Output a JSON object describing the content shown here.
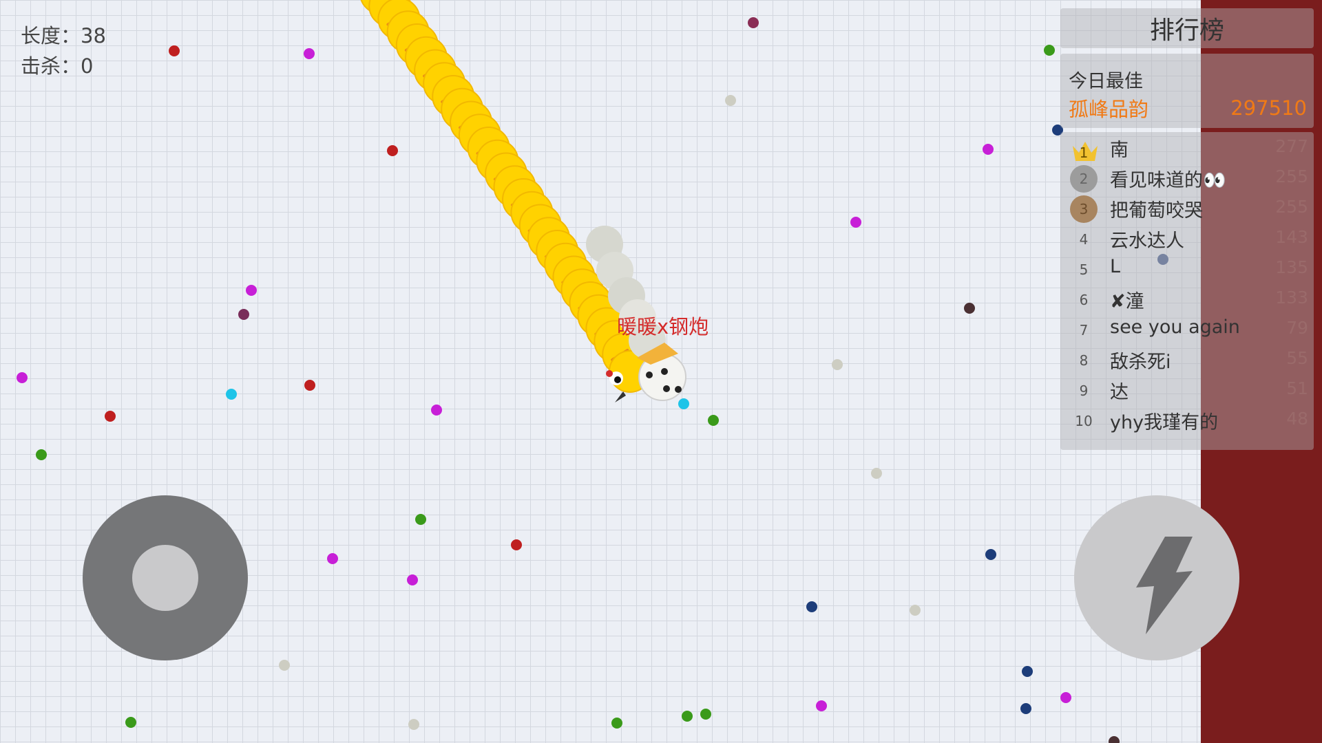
{
  "stats": {
    "length_label": "长度：38",
    "kills_label": "击杀：0"
  },
  "player": {
    "name": "暖暖x钢炮",
    "name_color": "#d42b2b"
  },
  "leaderboard": {
    "title": "排行榜",
    "best_label": "今日最佳",
    "best_name": "孤峰品韵",
    "best_score": "297510",
    "entries": [
      {
        "rank": "1",
        "name": "南",
        "score": "277"
      },
      {
        "rank": "2",
        "name": "看见味道的👀",
        "score": "255"
      },
      {
        "rank": "3",
        "name": "把葡萄咬哭",
        "score": "255"
      },
      {
        "rank": "4",
        "name": "云水达人",
        "score": "143"
      },
      {
        "rank": "5",
        "name": "L",
        "score": "135"
      },
      {
        "rank": "6",
        "name": "✘潼",
        "score": "133"
      },
      {
        "rank": "7",
        "name": "see you again",
        "score": "79"
      },
      {
        "rank": "8",
        "name": "敌杀死i",
        "score": "55"
      },
      {
        "rank": "9",
        "name": "达",
        "score": "51"
      },
      {
        "rank": "10",
        "name": "yhy我瑾有的",
        "score": "48"
      }
    ]
  },
  "controls": {
    "joystick_icon": "joystick",
    "boost_icon": "lightning-bolt-icon"
  },
  "colors": {
    "map_border": "#7a1d1d",
    "player_snake": "#ffd200",
    "best_highlight": "#f07a16"
  }
}
